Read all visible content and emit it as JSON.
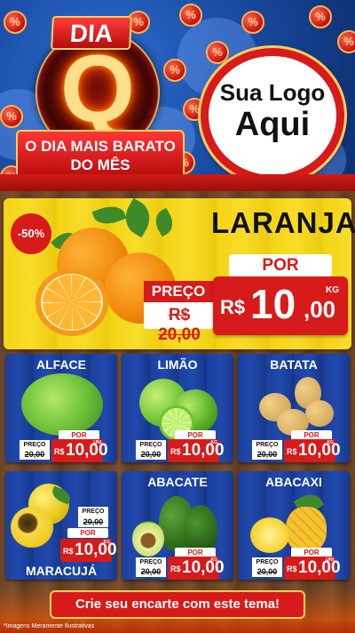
{
  "header": {
    "badge_top": "DIA",
    "badge_letter": "Q",
    "ribbon_line1": "O DIA MAIS BARATO",
    "ribbon_line2": "DO MÊS",
    "coin_symbol": "%",
    "logo_line1": "Sua Logo",
    "logo_line2": "Aqui"
  },
  "featured": {
    "discount": "-50%",
    "name": "LARANJA",
    "por_label": "POR",
    "preco_label": "PREÇO",
    "old_price": "R$ 20,00",
    "currency": "R$",
    "price_int": "10",
    "price_dec": ",00",
    "unit": "KG"
  },
  "products": [
    {
      "name": "ALFACE",
      "preco_label": "PREÇO",
      "old_price": "20,00",
      "por_label": "POR",
      "currency": "R$",
      "price": "10,00",
      "unit": "UNI"
    },
    {
      "name": "LIMÃO",
      "preco_label": "PREÇO",
      "old_price": "20,00",
      "por_label": "POR",
      "currency": "R$",
      "price": "10,00",
      "unit": "KG"
    },
    {
      "name": "BATATA",
      "preco_label": "PREÇO",
      "old_price": "20,00",
      "por_label": "POR",
      "currency": "R$",
      "price": "10,00",
      "unit": "KG"
    },
    {
      "name": "MARACUJÁ",
      "preco_label": "PREÇO",
      "old_price": "20,00",
      "por_label": "POR",
      "currency": "R$",
      "price": "10,00",
      "unit": "KG"
    },
    {
      "name": "ABACATE",
      "preco_label": "PREÇO",
      "old_price": "20,00",
      "por_label": "POR",
      "currency": "R$",
      "price": "10,00",
      "unit": "KG"
    },
    {
      "name": "ABACAXI",
      "preco_label": "PREÇO",
      "old_price": "20,00",
      "por_label": "POR",
      "currency": "R$",
      "price": "10,00",
      "unit": "UNI"
    }
  ],
  "footer": {
    "cta": "Crie seu encarte com este tema!",
    "disclaimer": "*Imagens Meramente Ilustrativas"
  },
  "colors": {
    "red": "#d71a1a",
    "yellow": "#f3d414",
    "blue": "#1b3f9c",
    "gold": "#ffcf5a"
  }
}
